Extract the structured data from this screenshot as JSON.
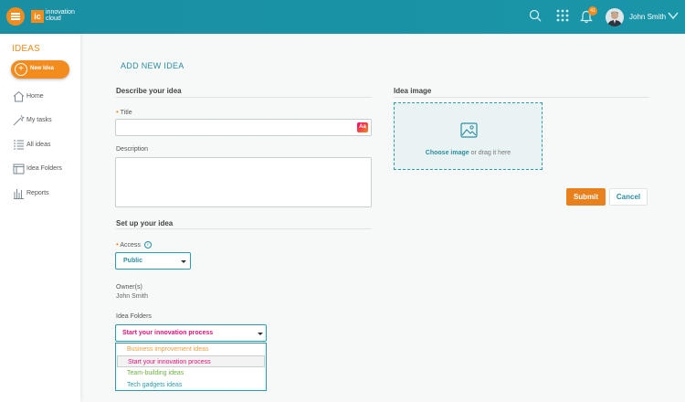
{
  "header": {
    "logo_mark": "ic",
    "logo_line1": "innovation",
    "logo_line2": "cloud",
    "notification_count": "41",
    "user_name": "John Smith"
  },
  "sidebar": {
    "title": "IDEAS",
    "new_idea_label": "New Idea",
    "items": [
      {
        "label": "Home",
        "icon": "home-icon"
      },
      {
        "label": "My tasks",
        "icon": "tasks-icon"
      },
      {
        "label": "All ideas",
        "icon": "list-icon"
      },
      {
        "label": "Idea Folders",
        "icon": "folder-icon"
      },
      {
        "label": "Reports",
        "icon": "reports-icon"
      }
    ]
  },
  "page": {
    "title": "ADD NEW IDEA",
    "describe_heading": "Describe your idea",
    "title_label": "Title",
    "title_value": "",
    "format_button": "Aa",
    "description_label": "Description",
    "description_value": "",
    "setup_heading": "Set up your idea",
    "access_label": "Access",
    "access_value": "Public",
    "owner_label": "Owner(s)",
    "owner_value": "John Smith",
    "folders_label": "Idea Folders",
    "folders_value": "Start your innovation process",
    "folder_options": [
      {
        "label": "Business improvement ideas",
        "color": "#f0a040"
      },
      {
        "label": "Start your innovation process",
        "color": "#e0147a"
      },
      {
        "label": "Team-building ideas",
        "color": "#6cb33e"
      },
      {
        "label": "Tech gadgets ideas",
        "color": "#2a9db0"
      }
    ],
    "image_heading": "Idea image",
    "choose_image": "Choose image",
    "drag_hint": "or drag it here",
    "submit_label": "Submit",
    "cancel_label": "Cancel"
  },
  "colors": {
    "accent": "#f28c1e",
    "teal": "#1a8fa3"
  }
}
